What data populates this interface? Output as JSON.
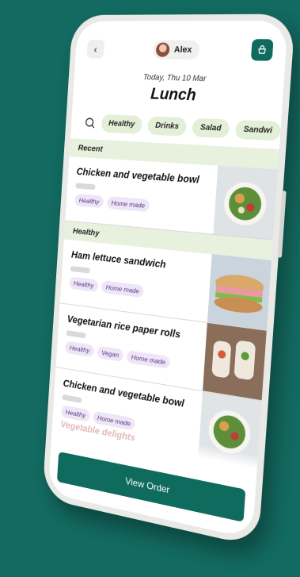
{
  "header": {
    "user_name": "Alex",
    "date": "Today, Thu 10 Mar",
    "meal": "Lunch"
  },
  "filters": [
    "Healthy",
    "Drinks",
    "Salad",
    "Sandwi"
  ],
  "sections": [
    {
      "title": "Recent",
      "items": [
        {
          "name": "Chicken and vegetable bowl",
          "tags": [
            "Healthy",
            "Home made"
          ]
        }
      ]
    },
    {
      "title": "Healthy",
      "items": [
        {
          "name": "Ham lettuce sandwich",
          "tags": [
            "Healthy",
            "Home made"
          ]
        },
        {
          "name": "Vegetarian rice paper rolls",
          "tags": [
            "Healthy",
            "Vegan",
            "Home made"
          ]
        },
        {
          "name": "Chicken and vegetable bowl",
          "tags": [
            "Healthy",
            "Home made"
          ]
        }
      ]
    }
  ],
  "partial_item": "Vegetable delights",
  "cta": {
    "view_order": "View Order"
  },
  "colors": {
    "primary": "#0f6b5e",
    "background": "#126a60",
    "section": "#e8f1de",
    "chip": "#e3efd6",
    "tag": "#eee6f6"
  }
}
